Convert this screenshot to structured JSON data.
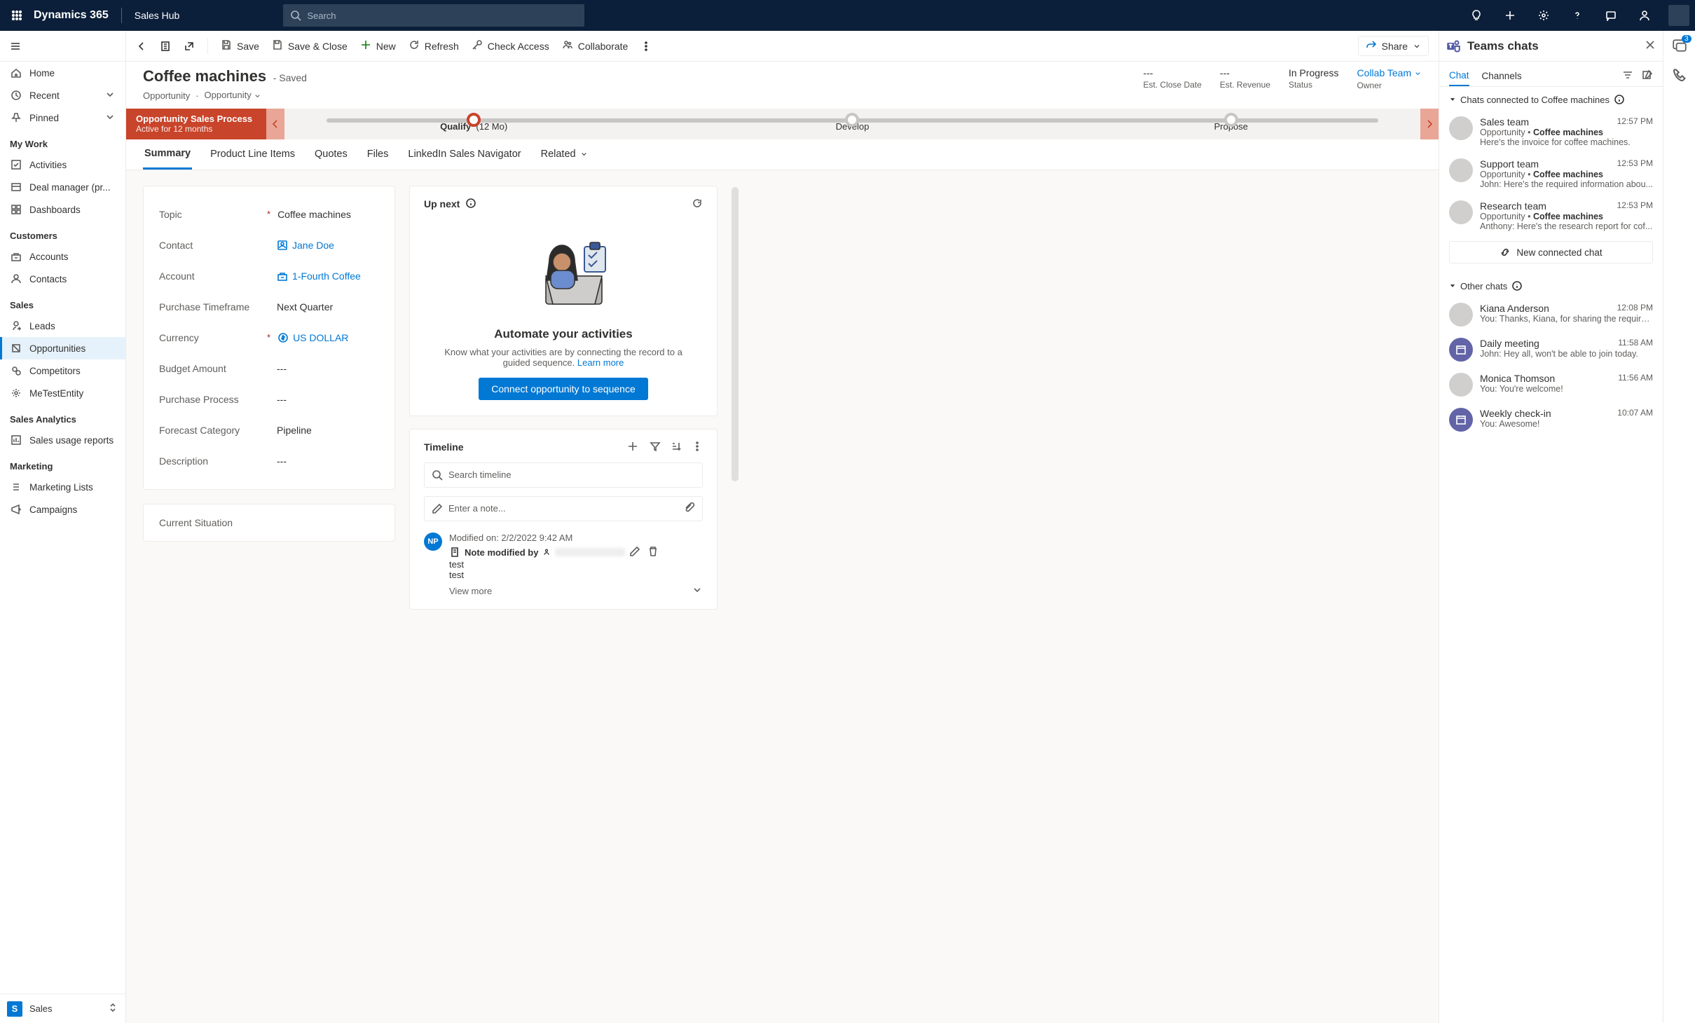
{
  "topnav": {
    "brand": "Dynamics 365",
    "app": "Sales Hub",
    "search_placeholder": "Search"
  },
  "leftnav": {
    "items": [
      {
        "icon": "home",
        "label": "Home"
      },
      {
        "icon": "clock",
        "label": "Recent",
        "chevron": true
      },
      {
        "icon": "pin",
        "label": "Pinned",
        "chevron": true
      }
    ],
    "groups": [
      {
        "heading": "My Work",
        "items": [
          {
            "icon": "check",
            "label": "Activities"
          },
          {
            "icon": "deal",
            "label": "Deal manager (pr..."
          },
          {
            "icon": "dash",
            "label": "Dashboards"
          }
        ]
      },
      {
        "heading": "Customers",
        "items": [
          {
            "icon": "account",
            "label": "Accounts"
          },
          {
            "icon": "person",
            "label": "Contacts"
          }
        ]
      },
      {
        "heading": "Sales",
        "items": [
          {
            "icon": "lead",
            "label": "Leads"
          },
          {
            "icon": "opp",
            "label": "Opportunities",
            "selected": true
          },
          {
            "icon": "comp",
            "label": "Competitors"
          },
          {
            "icon": "gear",
            "label": "MeTestEntity"
          }
        ]
      },
      {
        "heading": "Sales Analytics",
        "items": [
          {
            "icon": "report",
            "label": "Sales usage reports"
          }
        ]
      },
      {
        "heading": "Marketing",
        "items": [
          {
            "icon": "list",
            "label": "Marketing Lists"
          },
          {
            "icon": "camp",
            "label": "Campaigns"
          }
        ]
      }
    ],
    "area": {
      "initial": "S",
      "label": "Sales"
    }
  },
  "cmdbar": {
    "save": "Save",
    "save_close": "Save & Close",
    "new": "New",
    "refresh": "Refresh",
    "check_access": "Check Access",
    "collaborate": "Collaborate",
    "share": "Share"
  },
  "record": {
    "title": "Coffee machines",
    "saved_label": "- Saved",
    "entity": "Opportunity",
    "form": "Opportunity",
    "header": [
      {
        "value": "---",
        "label": "Est. Close Date"
      },
      {
        "value": "---",
        "label": "Est. Revenue"
      },
      {
        "value": "In Progress",
        "label": "Status"
      },
      {
        "value": "Collab Team",
        "label": "Owner",
        "link": true
      }
    ]
  },
  "process": {
    "name": "Opportunity Sales Process",
    "status": "Active for 12 months",
    "stages": [
      {
        "label": "Qualify",
        "detail": "(12 Mo)",
        "active": true
      },
      {
        "label": "Develop"
      },
      {
        "label": "Propose"
      }
    ]
  },
  "tabs": [
    "Summary",
    "Product Line Items",
    "Quotes",
    "Files",
    "LinkedIn Sales Navigator",
    "Related"
  ],
  "form": {
    "rows": [
      {
        "label": "Topic",
        "required": true,
        "value": "Coffee machines"
      },
      {
        "label": "Contact",
        "value": "Jane Doe",
        "link": true,
        "icon": "contact"
      },
      {
        "label": "Account",
        "value": "1-Fourth Coffee",
        "link": true,
        "icon": "account"
      },
      {
        "label": "Purchase Timeframe",
        "value": "Next Quarter"
      },
      {
        "label": "Currency",
        "required": true,
        "value": "US DOLLAR",
        "link": true,
        "icon": "currency"
      },
      {
        "label": "Budget Amount",
        "value": "---"
      },
      {
        "label": "Purchase Process",
        "value": "---"
      },
      {
        "label": "Forecast Category",
        "value": "Pipeline"
      },
      {
        "label": "Description",
        "value": "---"
      }
    ],
    "section2_label": "Current Situation"
  },
  "upnext": {
    "title": "Up next",
    "heading": "Automate your activities",
    "body": "Know what your activities are by connecting the record to a guided sequence. ",
    "learn_more": "Learn more",
    "button": "Connect opportunity to sequence"
  },
  "timeline": {
    "title": "Timeline",
    "search_placeholder": "Search timeline",
    "note_placeholder": "Enter a note...",
    "note": {
      "avatar": "NP",
      "modified": "Modified on: 2/2/2022 9:42 AM",
      "title": "Note modified by",
      "lines": [
        "test",
        "test"
      ],
      "view_more": "View more"
    }
  },
  "teams": {
    "title": "Teams chats",
    "tabs": [
      "Chat",
      "Channels"
    ],
    "section1": "Chats connected to Coffee machines",
    "section2": "Other chats",
    "connected": [
      {
        "name": "Sales team",
        "time": "12:57 PM",
        "ctx": "Opportunity • ",
        "bold": "Coffee machines",
        "preview": "Here's the invoice for coffee machines."
      },
      {
        "name": "Support team",
        "time": "12:53 PM",
        "ctx": "Opportunity • ",
        "bold": "Coffee machines",
        "preview": "John: Here's the required information abou..."
      },
      {
        "name": "Research team",
        "time": "12:53 PM",
        "ctx": "Opportunity • ",
        "bold": "Coffee machines",
        "preview": "Anthony: Here's the research report for cof..."
      }
    ],
    "new_chat": "New connected chat",
    "other": [
      {
        "name": "Kiana Anderson",
        "time": "12:08 PM",
        "preview": "You: Thanks, Kiana, for sharing the require..."
      },
      {
        "name": "Daily meeting",
        "time": "11:58 AM",
        "preview": "John: Hey all, won't be able to join today.",
        "cal": true
      },
      {
        "name": "Monica Thomson",
        "time": "11:56 AM",
        "preview": "You: You're welcome!"
      },
      {
        "name": "Weekly check-in",
        "time": "10:07 AM",
        "preview": "You: Awesome!",
        "cal": true
      }
    ]
  },
  "rail": {
    "badge": "3"
  }
}
